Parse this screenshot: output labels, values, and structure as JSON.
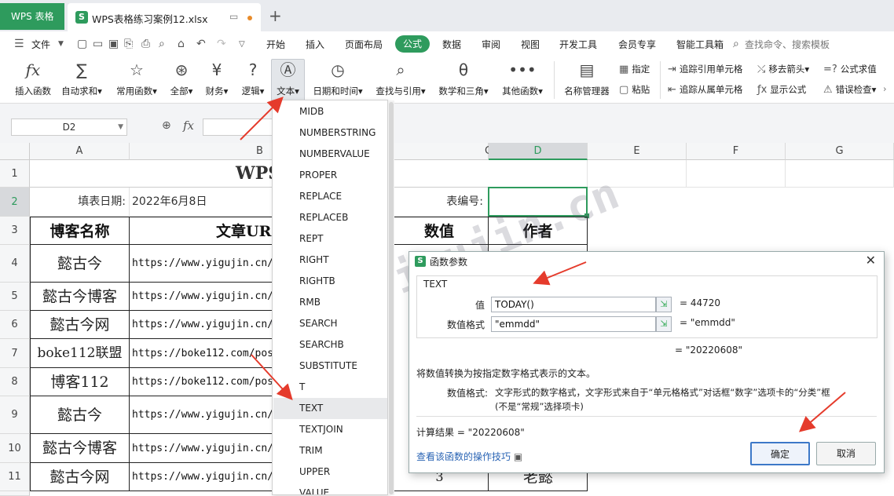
{
  "titlebar": {
    "app_label": "WPS 表格",
    "file_name": "WPS表格练习案例12.xlsx",
    "new_tab": "+"
  },
  "menu": {
    "file": "文件",
    "tabs": [
      "开始",
      "插入",
      "页面布局",
      "公式",
      "数据",
      "审阅",
      "视图",
      "开发工具",
      "会员专享",
      "智能工具箱"
    ],
    "active": "公式",
    "search": "查找命令、搜索模板"
  },
  "ribbon": {
    "insert_func": "插入函数",
    "autosum": "自动求和",
    "common": "常用函数",
    "all": "全部",
    "finance": "财务",
    "logic": "逻辑",
    "text": "文本",
    "datetime": "日期和时间",
    "lookup": "查找与引用",
    "math": "数学和三角",
    "other": "其他函数",
    "name_mgr": "名称管理器",
    "specify": "指定",
    "paste": "粘贴",
    "trace_prec": "追踪引用单元格",
    "trace_dep": "追踪从属单元格",
    "remove_arrows": "移去箭头",
    "show_formula": "显示公式",
    "eval": "公式求值",
    "error_check": "错误检查"
  },
  "formula_bar": {
    "name_box": "D2",
    "fx": "fx"
  },
  "sheet": {
    "columns": [
      "A",
      "B",
      "C",
      "D",
      "E",
      "F",
      "G"
    ],
    "selected_col": "D",
    "rows": [
      "1",
      "2",
      "3",
      "4",
      "5",
      "6",
      "7",
      "8",
      "9",
      "10",
      "11"
    ],
    "selected_row": "2",
    "title_partial": "WPS",
    "date_label": "填表日期:",
    "date_value": "2022年6月8日",
    "form_no_label": "表编号:",
    "headers": {
      "a": "博客名称",
      "b": "文章URL",
      "c": "数值",
      "d": "作者"
    },
    "names": [
      "懿古今",
      "懿古今博客",
      "懿古今网",
      "boke112联盟",
      "博客112",
      "懿古今",
      "懿古今博客",
      "懿古今网"
    ],
    "urls": [
      "https://www.yigujin.cn/",
      "https://www.yigujin.cn/",
      "https://www.yigujin.cn/",
      "https://boke112.com/pos",
      "https://boke112.com/pos",
      "https://www.yigujin.cn/",
      "https://www.yigujin.cn/",
      "https://www.yigujin.cn/"
    ],
    "r11_value": "3",
    "r11_author": "老懿"
  },
  "dropdown": {
    "items": [
      "MIDB",
      "NUMBERSTRING",
      "NUMBERVALUE",
      "PROPER",
      "REPLACE",
      "REPLACEB",
      "REPT",
      "RIGHT",
      "RIGHTB",
      "RMB",
      "SEARCH",
      "SEARCHB",
      "SUBSTITUTE",
      "T",
      "TEXT",
      "TEXTJOIN",
      "TRIM",
      "UPPER",
      "VALUE"
    ],
    "highlighted": "TEXT"
  },
  "dialog": {
    "title": "函数参数",
    "func_name": "TEXT",
    "arg1_label": "值",
    "arg1_value": "TODAY()",
    "arg1_result": "= 44720",
    "arg2_label": "数值格式",
    "arg2_value": "\"emmdd\"",
    "arg2_result": "= \"emmdd\"",
    "func_result": "= \"20220608\"",
    "description": "将数值转换为按指定数字格式表示的文本。",
    "param_name": "数值格式:",
    "param_desc_1": "文字形式的数字格式，文字形式来自于“单元格格式”对话框“数字”选项卡的“分类”框",
    "param_desc_2": "(不是“常规”选择项卡)",
    "calc_result": "计算结果 = \"20220608\"",
    "help_link": "查看该函数的操作技巧",
    "ok": "确定",
    "cancel": "取消"
  },
  "watermark": "www.yigujin.cn",
  "colors": {
    "accent": "#2e9b5d",
    "arrow": "#e53b2c",
    "ok_border": "#3c78c8"
  }
}
